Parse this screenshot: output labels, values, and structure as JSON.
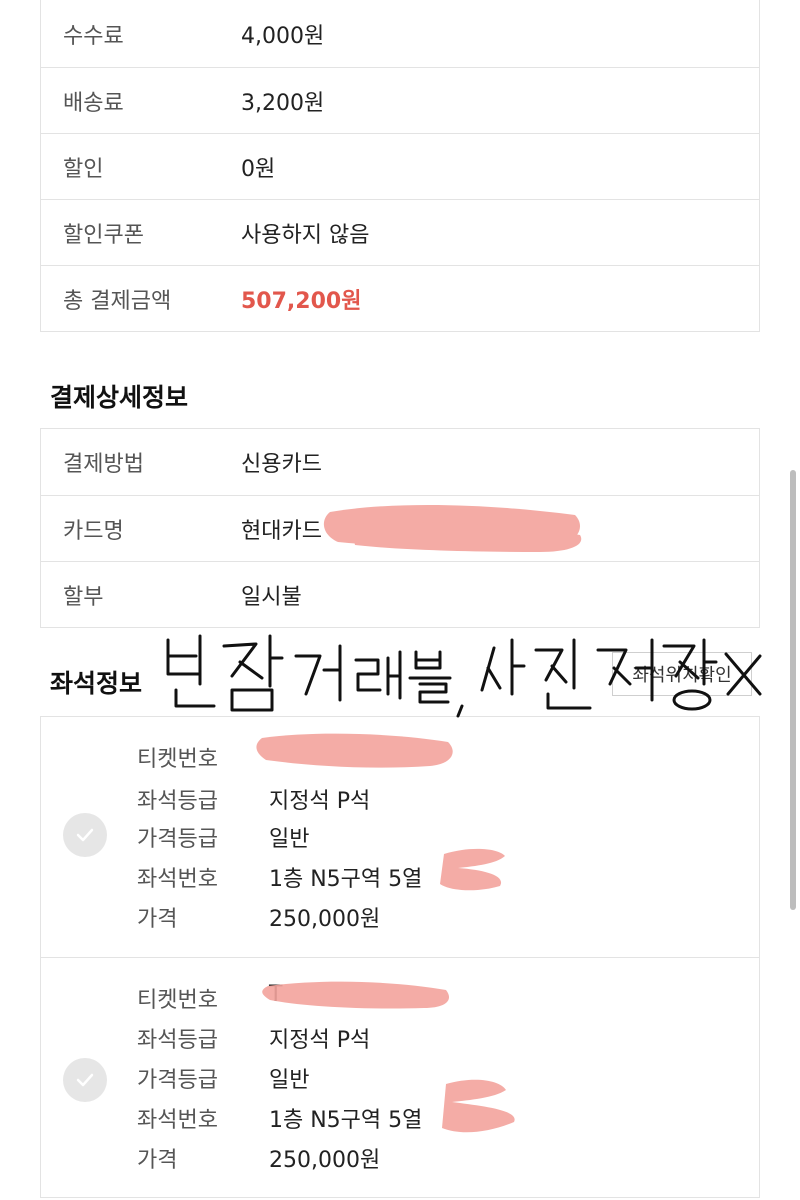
{
  "fees": [
    {
      "label": "수수료",
      "value": "4,000원"
    },
    {
      "label": "배송료",
      "value": "3,200원"
    },
    {
      "label": "할인",
      "value": "0원"
    },
    {
      "label": "할인쿠폰",
      "value": "사용하지 않음"
    },
    {
      "label": "총 결제금액",
      "value": "507,200원"
    }
  ],
  "payment_title": "결제상세정보",
  "payment": [
    {
      "label": "결제방법",
      "value": "신용카드"
    },
    {
      "label": "카드명",
      "value": "현대카드"
    },
    {
      "label": "할부",
      "value": "일시불"
    }
  ],
  "seat_title": "좌석정보",
  "seat_location_button": "좌석위치확인",
  "seats": [
    {
      "ticket_label": "티켓번호",
      "ticket_value": "",
      "grade_label": "좌석등급",
      "grade_value": "지정석 P석",
      "price_grade_label": "가격등급",
      "price_grade_value": "일반",
      "seat_no_label": "좌석번호",
      "seat_no_value": "1층 N5구역 5열",
      "price_label": "가격",
      "price_value": "250,000원"
    },
    {
      "ticket_label": "티켓번호",
      "ticket_value": "T",
      "grade_label": "좌석등급",
      "grade_value": "지정석 P석",
      "price_grade_label": "가격등급",
      "price_grade_value": "일반",
      "seat_no_label": "좌석번호",
      "seat_no_value": "1층 N5구역 5열",
      "price_label": "가격",
      "price_value": "250,000원"
    }
  ],
  "handwriting": "빈잠 거래불, 사진저장X",
  "colors": {
    "total_red": "#e2574c",
    "redaction_pink": "#f3a39c",
    "border": "#e3e3e3"
  }
}
